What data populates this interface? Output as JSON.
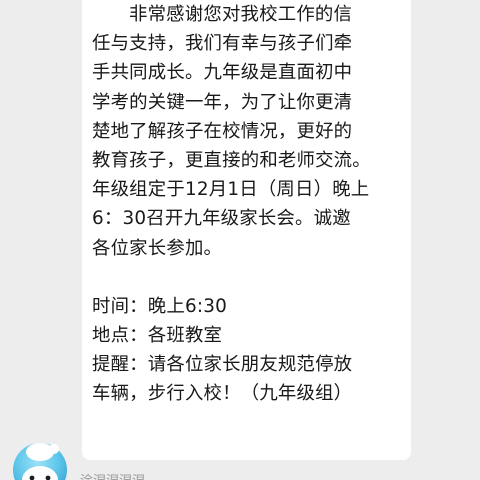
{
  "message": {
    "lines": [
      "非常感谢您对我校工作的信",
      "任与支持，我们有幸与孩子们牵",
      "手共同成长。九年级是直面初中",
      "学考的关键一年，为了让你更清",
      "楚地了解孩子在校情况，更好的",
      "教育孩子，更直接的和老师交流。",
      "年级组定于12月1日（周日）晚上",
      "6：30召开九年级家长会。诚邀",
      "各位家长参加。",
      "时间：晚上6:30",
      "地点：各班教室",
      "提醒：请各位家长朋友规范停放",
      "车辆，步行入校！（九年级组）"
    ]
  },
  "next_message": {
    "sender_partial": "涂涅涅涅涅"
  },
  "colors": {
    "chat_background": "#ededed",
    "bubble_background": "#ffffff",
    "avatar_blue": "#5fc6ea"
  },
  "icons": {
    "avatar": "snowman-avatar-icon"
  }
}
